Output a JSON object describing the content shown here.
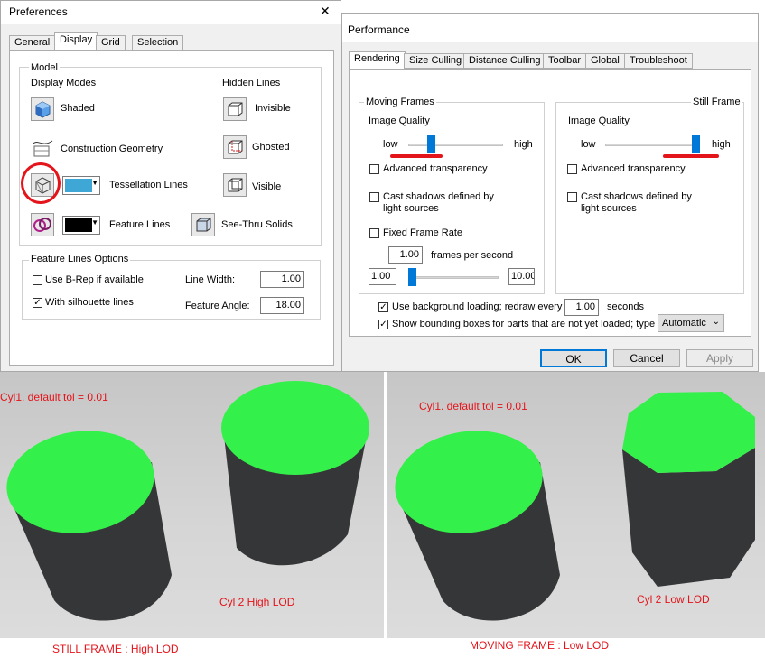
{
  "preferences": {
    "title": "Preferences",
    "close_symbol": "✕",
    "tabs": [
      "General",
      "Display",
      "Grid",
      "Selection"
    ],
    "active_tab": "Display",
    "model_group": {
      "title": "Model",
      "display_modes_label": "Display Modes",
      "hidden_lines_label": "Hidden Lines",
      "display_modes": [
        {
          "label": "Shaded",
          "icon": "shaded-cube-icon"
        },
        {
          "label": "Construction Geometry",
          "icon": "construction-geometry-icon"
        },
        {
          "label": "Tessellation Lines",
          "icon": "tessellation-cube-icon",
          "color": "#3fa7d6"
        },
        {
          "label": "Feature Lines",
          "icon": "feature-lines-icon",
          "color": "#000000"
        }
      ],
      "hidden_lines": [
        {
          "label": "Invisible",
          "icon": "invisible-lines-icon"
        },
        {
          "label": "Ghosted",
          "icon": "ghosted-lines-icon"
        },
        {
          "label": "Visible",
          "icon": "visible-lines-icon"
        },
        {
          "label": "See-Thru Solids",
          "icon": "see-thru-solids-icon"
        }
      ]
    },
    "feature_lines_options": {
      "title": "Feature Lines Options",
      "brep": {
        "label": "Use B-Rep if available",
        "checked": false
      },
      "silhouette": {
        "label": "With silhouette lines",
        "checked": true
      },
      "line_width": {
        "label": "Line Width:",
        "value": "1.00"
      },
      "feature_angle": {
        "label": "Feature Angle:",
        "value": "18.00"
      }
    }
  },
  "performance": {
    "title": "Performance",
    "tabs": [
      "Rendering",
      "Size Culling",
      "Distance Culling",
      "Toolbar",
      "Global",
      "Troubleshoot"
    ],
    "active_tab": "Rendering",
    "moving_frames": {
      "title": "Moving Frames",
      "image_quality_label": "Image Quality",
      "low_label": "low",
      "high_label": "high",
      "quality_fraction": 0.22,
      "advanced_transparency": {
        "label": "Advanced transparency",
        "checked": false
      },
      "cast_shadows": {
        "label_line1": "Cast shadows defined by",
        "label_line2": "light sources",
        "checked": false
      },
      "fixed_frame_rate": {
        "label": "Fixed Frame Rate",
        "checked": false
      },
      "fps_value": "1.00",
      "fps_label": "frames per second",
      "fps_min": "1.00",
      "fps_max": "10.00",
      "fps_fraction": 0.0
    },
    "still_frame": {
      "title": "Still Frame",
      "image_quality_label": "Image Quality",
      "low_label": "low",
      "high_label": "high",
      "quality_fraction": 1.0,
      "advanced_transparency": {
        "label": "Advanced transparency",
        "checked": false
      },
      "cast_shadows": {
        "label_line1": "Cast shadows defined by",
        "label_line2": "light sources",
        "checked": false
      }
    },
    "background_loading": {
      "label": "Use background loading; redraw every",
      "value": "1.00",
      "unit": "seconds",
      "checked": true
    },
    "bounding_boxes": {
      "label": "Show bounding boxes for parts that are not yet loaded; type",
      "value": "Automatic",
      "checked": true
    },
    "buttons": {
      "ok": "OK",
      "cancel": "Cancel",
      "apply": "Apply"
    }
  },
  "scenes": {
    "still": {
      "cyl1_label": "Cyl1. default tol = 0.01",
      "cyl2_label": "Cyl 2 High LOD",
      "caption": "STILL FRAME : High LOD"
    },
    "moving": {
      "cyl1_label": "Cyl1. default tol = 0.01",
      "cyl2_label": "Cyl 2 Low LOD",
      "caption": "MOVING FRAME : Low LOD"
    }
  },
  "colors": {
    "accent": "#0078d7",
    "annotation": "#e4141b",
    "cylinder_top": "#33f14a",
    "cylinder_body": "#353637"
  }
}
